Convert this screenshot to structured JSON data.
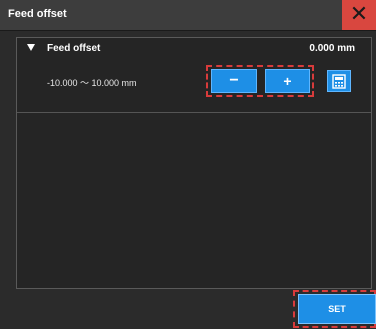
{
  "window": {
    "title": "Feed offset",
    "close_icon": "close-icon"
  },
  "section": {
    "title": "Feed offset",
    "value": "0.000 mm",
    "range": "-10.000 〜 10.000 mm",
    "expanded": true
  },
  "stepper": {
    "minus_label": "−",
    "plus_label": "+"
  },
  "calculator": {
    "icon": "calculator-icon"
  },
  "footer": {
    "set_label": "SET"
  },
  "colors": {
    "accent": "#1e8fe6",
    "close": "#d9473f",
    "highlight": "#d83b3b",
    "background": "#2b2b2b"
  }
}
